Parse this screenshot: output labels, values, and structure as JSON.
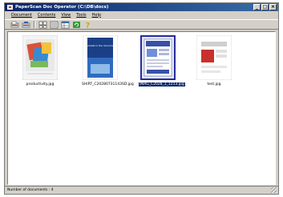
{
  "window": {
    "title": "PaperScan Doc Operator (C:\\DB\\docs)"
  },
  "menu": [
    "Document",
    "Contents",
    "View",
    "Tools",
    "Help"
  ],
  "toolbar": {
    "icons": [
      "scan-icon",
      "scan-batch-icon",
      "thumbnails-icon",
      "list-view-icon",
      "detail-view-icon",
      "refresh-icon",
      "help-icon"
    ]
  },
  "documents": [
    {
      "label": "productivity.jpg",
      "selected": false
    },
    {
      "label": "SHIRT_C20280731143SD.jpg",
      "selected": false
    },
    {
      "label": "IMAG_C2028_1_1213.jpg",
      "selected": true
    },
    {
      "label": "test.jpg",
      "selected": false
    }
  ],
  "thumbnails": {
    "doc2_text": "specialist in the documents"
  },
  "status": {
    "text": "Number of documents : 4"
  },
  "colors": {
    "titlebar_start": "#0a246a",
    "titlebar_end": "#3a6ea5",
    "selection": "#0a246a"
  }
}
